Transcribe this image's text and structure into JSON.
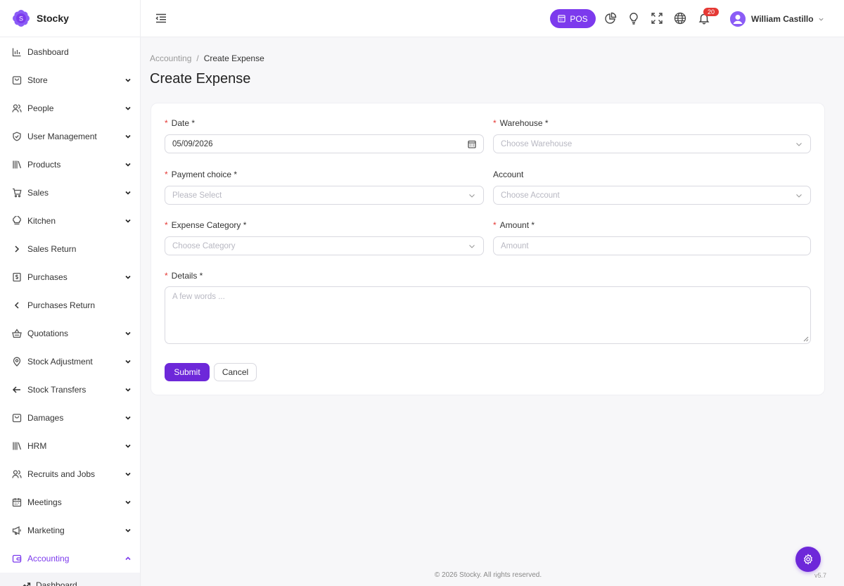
{
  "brand": {
    "name": "Stocky",
    "logo_letter": "S"
  },
  "sidebar": {
    "items": [
      {
        "label": "Dashboard",
        "icon": "bar-chart-icon",
        "chevron": "none"
      },
      {
        "label": "Store",
        "icon": "store-bag-icon",
        "chevron": "down"
      },
      {
        "label": "People",
        "icon": "people-icon",
        "chevron": "down"
      },
      {
        "label": "User Management",
        "icon": "shield-check-icon",
        "chevron": "down"
      },
      {
        "label": "Products",
        "icon": "books-icon",
        "chevron": "down"
      },
      {
        "label": "Sales",
        "icon": "cart-icon",
        "chevron": "down"
      },
      {
        "label": "Kitchen",
        "icon": "chef-hat-icon",
        "chevron": "down"
      },
      {
        "label": "Sales Return",
        "icon": "chevron-right-icon",
        "chevron": "none"
      },
      {
        "label": "Purchases",
        "icon": "invoice-icon",
        "chevron": "down"
      },
      {
        "label": "Purchases Return",
        "icon": "chevron-left-icon",
        "chevron": "none"
      },
      {
        "label": "Quotations",
        "icon": "basket-icon",
        "chevron": "down"
      },
      {
        "label": "Stock Adjustment",
        "icon": "location-pin-icon",
        "chevron": "down"
      },
      {
        "label": "Stock Transfers",
        "icon": "arrow-left-icon",
        "chevron": "down"
      },
      {
        "label": "Damages",
        "icon": "store-bag-icon",
        "chevron": "down"
      },
      {
        "label": "HRM",
        "icon": "books-icon",
        "chevron": "down"
      },
      {
        "label": "Recruits and Jobs",
        "icon": "people-icon",
        "chevron": "down"
      },
      {
        "label": "Meetings",
        "icon": "calendar-icon",
        "chevron": "down"
      },
      {
        "label": "Marketing",
        "icon": "megaphone-icon",
        "chevron": "down"
      },
      {
        "label": "Accounting",
        "icon": "wallet-icon",
        "chevron": "up"
      }
    ],
    "sub_item": {
      "label": "Dashboard",
      "icon": "trend-up-icon"
    }
  },
  "header": {
    "pos_label": "POS",
    "notification_count": "20",
    "user_name": "William Castillo"
  },
  "breadcrumb": {
    "parent": "Accounting",
    "separator": "/",
    "current": "Create Expense"
  },
  "page_title": "Create Expense",
  "form": {
    "date": {
      "label": "Date *",
      "value": "05/09/2026"
    },
    "warehouse": {
      "label": "Warehouse *",
      "placeholder": "Choose Warehouse"
    },
    "payment_choice": {
      "label": "Payment choice *",
      "placeholder": "Please Select"
    },
    "account": {
      "label": "Account",
      "placeholder": "Choose Account"
    },
    "expense_category": {
      "label": "Expense Category *",
      "placeholder": "Choose Category"
    },
    "amount": {
      "label": "Amount *",
      "placeholder": "Amount"
    },
    "details": {
      "label": "Details *",
      "placeholder": "A few words ..."
    },
    "submit_label": "Submit",
    "cancel_label": "Cancel"
  },
  "footer": {
    "copyright": "© 2026 Stocky. All rights reserved.",
    "version": "v5.7"
  },
  "colors": {
    "accent": "#7c3aed",
    "required": "#e53935",
    "badge": "#e53935"
  }
}
